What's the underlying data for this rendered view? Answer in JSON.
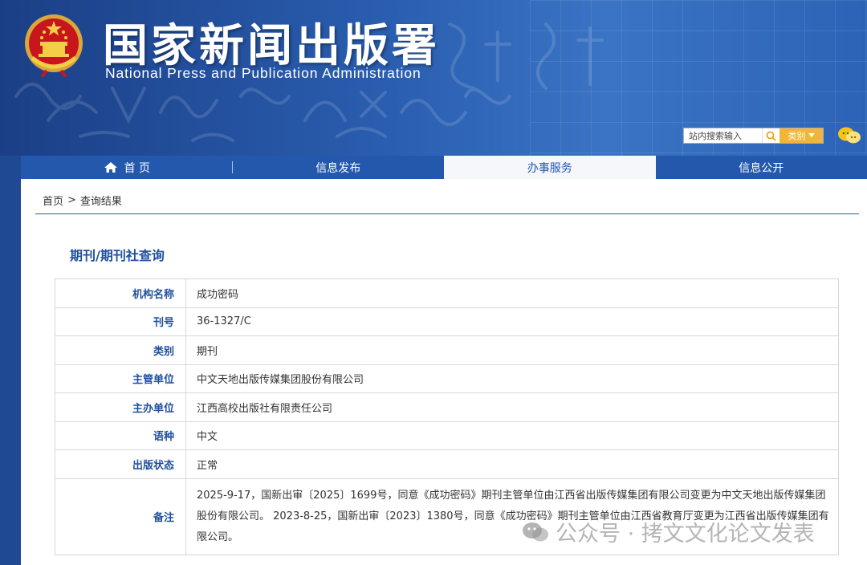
{
  "header": {
    "title_cn": "国家新闻出版署",
    "title_en": "National  Press and Publication Administration",
    "search_placeholder": "站内搜索输入",
    "category_label": "类别"
  },
  "nav": {
    "items": [
      {
        "label": "首 页"
      },
      {
        "label": "信息发布"
      },
      {
        "label": "办事服务"
      },
      {
        "label": "信息公开"
      }
    ]
  },
  "breadcrumb": {
    "home": "首页",
    "separator": ">",
    "current": "查询结果"
  },
  "page_title": "期刊/期刊社查询",
  "table": {
    "rows": [
      {
        "label": "机构名称",
        "value": "成功密码"
      },
      {
        "label": "刊号",
        "value": "36-1327/C"
      },
      {
        "label": "类别",
        "value": "期刊"
      },
      {
        "label": "主管单位",
        "value": "中文天地出版传媒集团股份有限公司"
      },
      {
        "label": "主办单位",
        "value": "江西高校出版社有限责任公司"
      },
      {
        "label": "语种",
        "value": "中文"
      },
      {
        "label": "出版状态",
        "value": "正常"
      },
      {
        "label": "备注",
        "value": "2025-9-17，国新出审〔2025〕1699号，同意《成功密码》期刊主管单位由江西省出版传媒集团有限公司变更为中文天地出版传媒集团股份有限公司。 2023-8-25，国新出审〔2023〕1380号，同意《成功密码》期刊主管单位由江西省教育厅变更为江西省出版传媒集团有限公司。"
      }
    ]
  },
  "watermark": "公众号 · 拷文文化论文发表",
  "colors": {
    "brand_blue": "#2458ad",
    "label_blue": "#1f4f9e",
    "category_orange": "#f2b53a"
  }
}
